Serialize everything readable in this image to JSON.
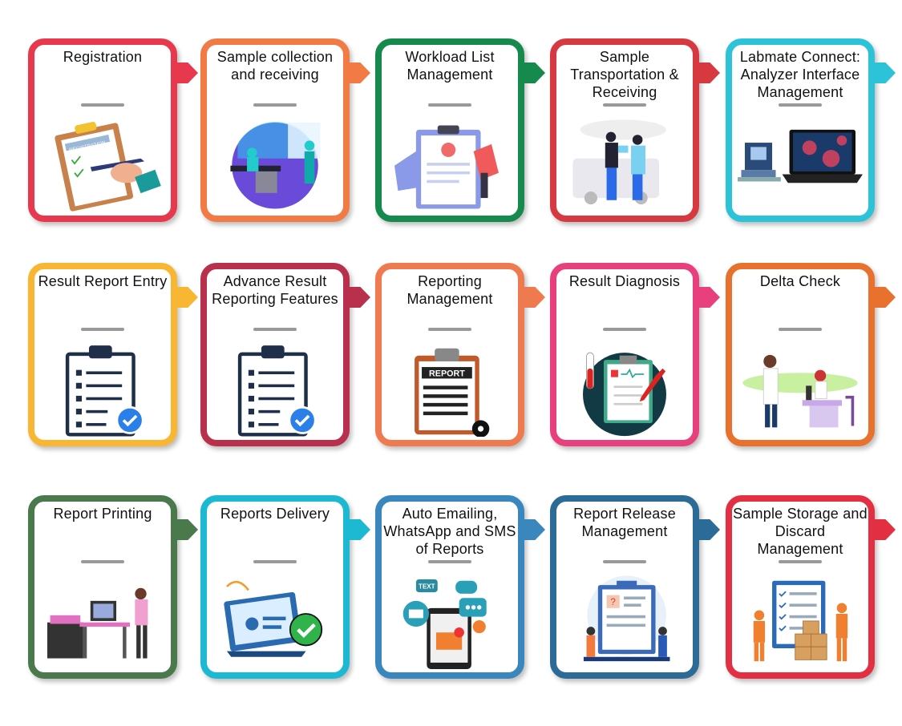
{
  "steps": [
    {
      "title": "Registration",
      "color": "#e8384d",
      "icon": "registration-clipboard"
    },
    {
      "title": "Sample collection and receiving",
      "color": "#f27b45",
      "icon": "lab-scientists"
    },
    {
      "title": "Workload List Management",
      "color": "#168a4c",
      "icon": "workload-clipboard"
    },
    {
      "title": "Sample Transportation & Receiving",
      "color": "#d63a40",
      "icon": "transport-ambulance"
    },
    {
      "title": "Labmate Connect: Analyzer Interface Management",
      "color": "#2cc3d8",
      "icon": "analyzer-laptop"
    },
    {
      "title": "Result Report Entry",
      "color": "#f9b632",
      "icon": "checklist-clipboard"
    },
    {
      "title": "Advance Result Reporting Features",
      "color": "#b8304c",
      "icon": "checklist-clipboard"
    },
    {
      "title": "Reporting Management",
      "color": "#f07a50",
      "icon": "report-gear"
    },
    {
      "title": "Result Diagnosis",
      "color": "#e8407c",
      "icon": "diagnosis-clipboard"
    },
    {
      "title": "Delta Check",
      "color": "#e8712d",
      "icon": "lab-microscope"
    },
    {
      "title": "Report Printing",
      "color": "#4a7a4c",
      "icon": "printer-desk"
    },
    {
      "title": "Reports Delivery",
      "color": "#1db9d2",
      "icon": "laptop-check"
    },
    {
      "title": "Auto Emailing, WhatsApp and SMS of Reports",
      "color": "#3a87bd",
      "icon": "phone-messages"
    },
    {
      "title": "Report Release Management",
      "color": "#2c6a98",
      "icon": "release-board"
    },
    {
      "title": "Sample Storage and Discard Management",
      "color": "#e23042",
      "icon": "storage-boxes"
    }
  ],
  "labels": {
    "report": "REPORT",
    "registration": "REGISTRATION",
    "text": "TEXT"
  }
}
